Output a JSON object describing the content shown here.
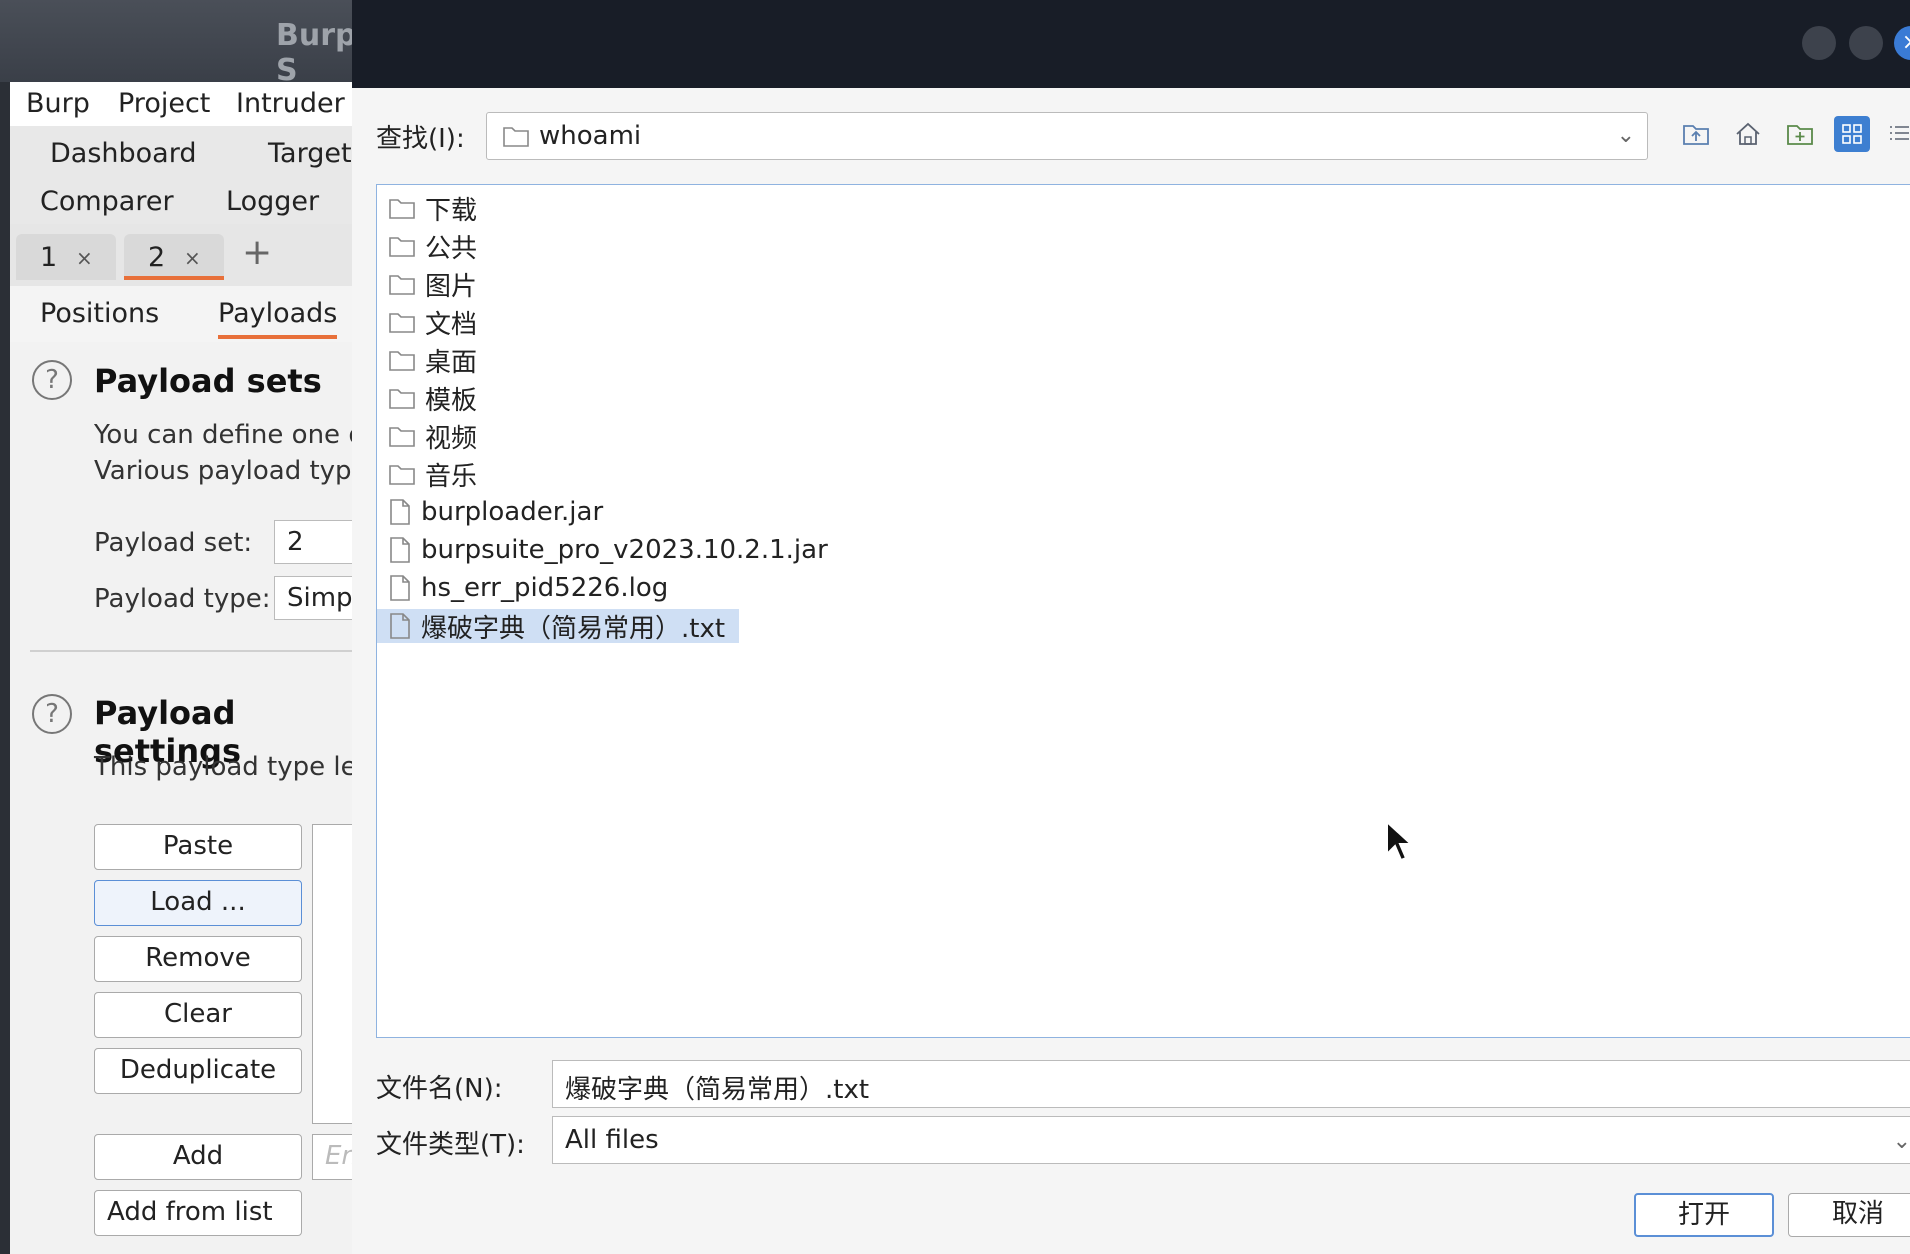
{
  "burp": {
    "title": "Burp S",
    "menu": [
      "Burp",
      "Project",
      "Intruder"
    ],
    "main_tabs": [
      "Dashboard",
      "Target",
      "Comparer",
      "Logger"
    ],
    "attack_tabs": [
      {
        "num": "1",
        "close": "×"
      },
      {
        "num": "2",
        "close": "×"
      }
    ],
    "add_tab": "+",
    "intruder_tabs": [
      "Positions",
      "Payloads"
    ],
    "payload_sets": {
      "title": "Payload sets",
      "desc_line1": "You can define one or",
      "desc_line2": "Various payload type",
      "set_label": "Payload set:",
      "set_value": "2",
      "type_label": "Payload type:",
      "type_value": "Simpl"
    },
    "payload_settings": {
      "title": "Payload settings",
      "desc": "This payload type lets"
    },
    "buttons": [
      "Paste",
      "Load ...",
      "Remove",
      "Clear",
      "Deduplicate"
    ],
    "add_button": "Add",
    "add_placeholder": "En",
    "add_from_list": "Add from list ..."
  },
  "dialog": {
    "lookin_label": "查找(I):",
    "lookin_value": "whoami",
    "files": [
      {
        "name": "下载",
        "type": "folder"
      },
      {
        "name": "公共",
        "type": "folder"
      },
      {
        "name": "图片",
        "type": "folder"
      },
      {
        "name": "文档",
        "type": "folder"
      },
      {
        "name": "桌面",
        "type": "folder"
      },
      {
        "name": "模板",
        "type": "folder"
      },
      {
        "name": "视频",
        "type": "folder"
      },
      {
        "name": "音乐",
        "type": "folder"
      },
      {
        "name": "burploader.jar",
        "type": "file"
      },
      {
        "name": "burpsuite_pro_v2023.10.2.1.jar",
        "type": "file"
      },
      {
        "name": "hs_err_pid5226.log",
        "type": "file"
      },
      {
        "name": "爆破字典（简易常用）.txt",
        "type": "file",
        "selected": true
      }
    ],
    "filename_label": "文件名(N):",
    "filename_value": "爆破字典（简易常用）.txt",
    "filetype_label": "文件类型(T):",
    "filetype_value": "All files",
    "open_button": "打开",
    "cancel_button": "取消"
  },
  "colors": {
    "selection": "#cfdff4",
    "accent": "#e8703a",
    "focus": "#5b8fd6"
  }
}
